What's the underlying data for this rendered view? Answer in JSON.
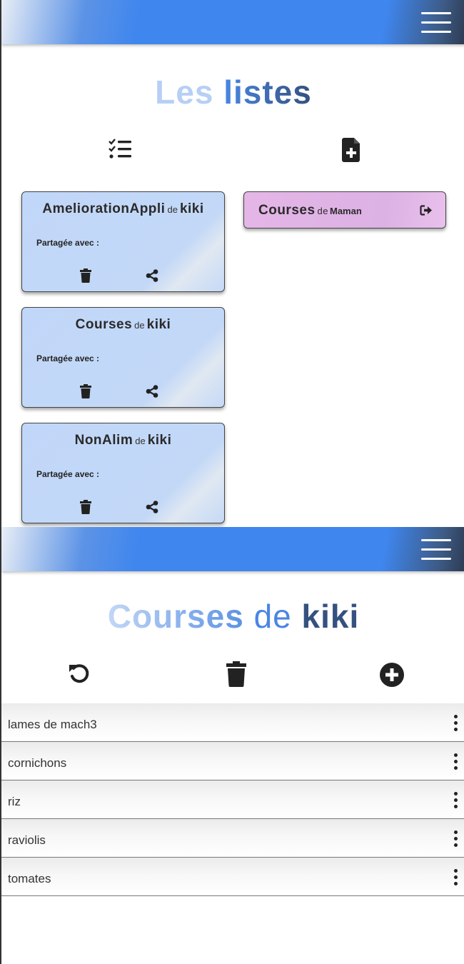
{
  "screen_lists": {
    "title": {
      "part1": "Les",
      "part2": "listes"
    },
    "toolbar": {
      "lists_icon": "checklist-icon",
      "new_list_icon": "file-plus-icon"
    },
    "owned_lists": [
      {
        "name": "AmeliorationAppli",
        "de": "de",
        "owner": "kiki",
        "shared_label": "Partagée avec :"
      },
      {
        "name": "Courses",
        "de": "de",
        "owner": "kiki",
        "shared_label": "Partagée avec :"
      },
      {
        "name": "NonAlim",
        "de": "de",
        "owner": "kiki",
        "shared_label": "Partagée avec :"
      }
    ],
    "shared_lists": [
      {
        "name": "Courses",
        "de": "de",
        "owner": "Maman"
      }
    ],
    "colors": {
      "owned_card": "#c1d7f9",
      "shared_card": "#e1b4e6",
      "navbar": "#3f86ee"
    }
  },
  "screen_detail": {
    "title": {
      "part1": "Courses",
      "part2": "de",
      "part3": "kiki"
    },
    "toolbar": {
      "refresh_icon": "refresh-icon",
      "delete_icon": "trash-icon",
      "add_icon": "plus-circle-icon"
    },
    "items": [
      {
        "label": "lames de mach3"
      },
      {
        "label": "cornichons"
      },
      {
        "label": "riz"
      },
      {
        "label": "raviolis"
      },
      {
        "label": "tomates"
      }
    ]
  },
  "navbar": {
    "menu_icon": "hamburger-icon"
  }
}
